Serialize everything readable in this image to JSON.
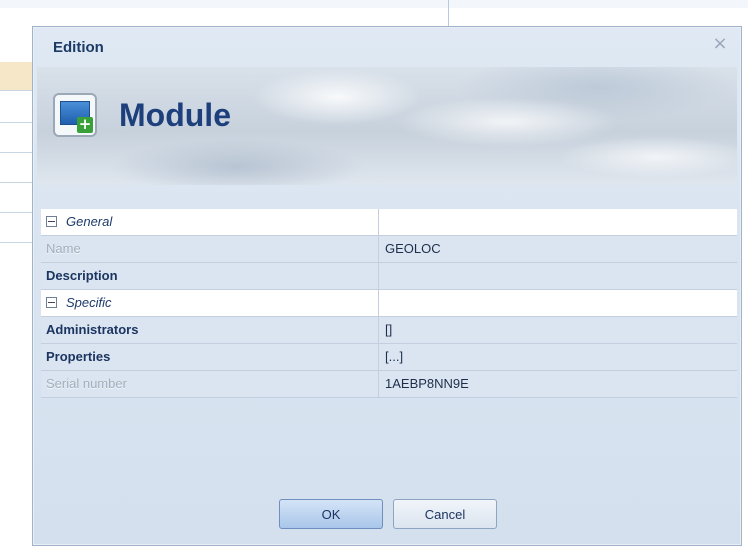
{
  "dialog": {
    "title": "Edition",
    "close_glyph": "×",
    "banner_title": "Module",
    "banner_icon": "module-add-icon"
  },
  "property_grid": {
    "groups": [
      {
        "label": "General",
        "rows": [
          {
            "name": "Name",
            "value": "GEOLOC",
            "style": "disabled"
          },
          {
            "name": "Description",
            "value": "",
            "style": "bold"
          }
        ]
      },
      {
        "label": "Specific",
        "rows": [
          {
            "name": "Administrators",
            "value": "[]",
            "style": "bold"
          },
          {
            "name": "Properties",
            "value": "[...]",
            "style": "bold"
          },
          {
            "name": "Serial number",
            "value": "1AEBP8NN9E",
            "style": "disabled"
          }
        ]
      }
    ]
  },
  "buttons": {
    "ok": "OK",
    "cancel": "Cancel"
  },
  "colors": {
    "accent": "#1d3f7c",
    "row_background": "#dbe5f1",
    "group_background": "#ffffff"
  }
}
